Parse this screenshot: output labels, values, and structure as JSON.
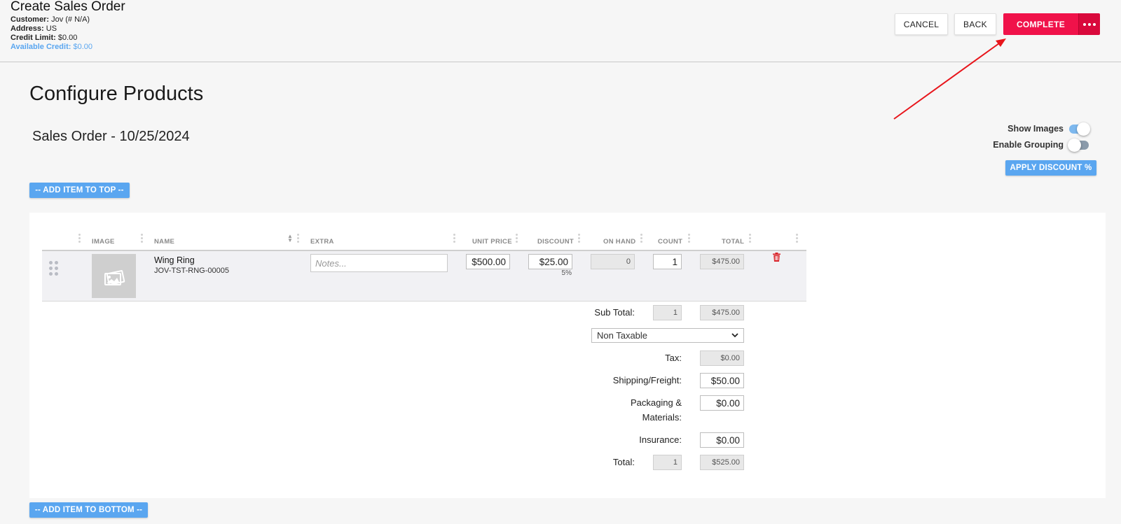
{
  "header": {
    "title": "Create Sales Order",
    "customer_label": "Customer:",
    "customer_value": "Jov (# N/A)",
    "address_label": "Address:",
    "address_value": "US",
    "credit_label": "Credit Limit:",
    "credit_value": "$0.00",
    "available_label": "Available Credit:",
    "available_value": "$0.00",
    "cancel_label": "CANCEL",
    "back_label": "BACK",
    "complete_label": "COMPLETE"
  },
  "main": {
    "section_title": "Configure Products",
    "order_title": "Sales Order - 10/25/2024",
    "show_images_label": "Show Images",
    "show_images_on": true,
    "enable_grouping_label": "Enable Grouping",
    "enable_grouping_on": false,
    "apply_discount_label": "APPLY DISCOUNT %",
    "add_top_label": "-- ADD ITEM TO TOP --",
    "add_bottom_label": "-- ADD ITEM TO BOTTOM --"
  },
  "table": {
    "columns": [
      "IMAGE",
      "NAME",
      "EXTRA",
      "UNIT PRICE",
      "DISCOUNT",
      "ON HAND",
      "COUNT",
      "TOTAL"
    ],
    "rows": [
      {
        "name": "Wing Ring",
        "sku": "JOV-TST-RNG-00005",
        "notes_placeholder": "Notes...",
        "unit_price": "$500.00",
        "discount": "$25.00",
        "discount_pct": "5%",
        "on_hand": "0",
        "count": "1",
        "total": "$475.00"
      }
    ]
  },
  "summary": {
    "subtotal_label": "Sub Total:",
    "subtotal_count": "1",
    "subtotal_value": "$475.00",
    "tax_option": "Non Taxable",
    "tax_label": "Tax:",
    "tax_value": "$0.00",
    "shipping_label": "Shipping/Freight:",
    "shipping_value": "$50.00",
    "packaging_label_1": "Packaging &",
    "packaging_label_2": "Materials:",
    "packaging_value": "$0.00",
    "insurance_label": "Insurance:",
    "insurance_value": "$0.00",
    "total_label": "Total:",
    "total_count": "1",
    "total_value": "$525.00"
  },
  "colors": {
    "complete": "#f0124a",
    "accent_blue": "#5aa6f0",
    "annotation_arrow": "#e8151b"
  },
  "icons": [
    "more-dots-icon",
    "drag-handle-icon",
    "image-placeholder-icon",
    "trash-icon",
    "sort-icon",
    "chevron-down-icon"
  ]
}
